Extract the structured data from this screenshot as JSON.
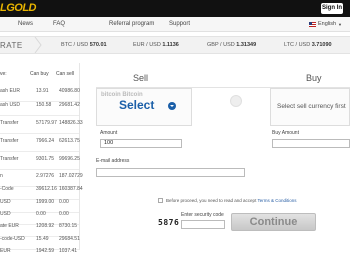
{
  "brand": {
    "logo": "LGOLD",
    "signin": "Sign In"
  },
  "nav": {
    "items": [
      "News",
      "FAQ",
      "Referral program",
      "Support"
    ],
    "language": "English"
  },
  "rates": {
    "label": "RATE",
    "items": [
      {
        "pair": "BTC / USD",
        "value": "570.01"
      },
      {
        "pair": "EUR / USD",
        "value": "1.1136"
      },
      {
        "pair": "GBP / USD",
        "value": "1.31349"
      },
      {
        "pair": "LTC / USD",
        "value": "3.71090"
      }
    ]
  },
  "left_table": {
    "head": "ve:",
    "col1": "Can buy",
    "col2": "Can sell",
    "rows": [
      {
        "name": "ash EUR",
        "v1": "13.91",
        "v2": "40986.80"
      },
      {
        "name": "ash USD",
        "v1": "150.58",
        "v2": "29681.42"
      },
      {
        "name": "Transfer",
        "v1": "57179.97",
        "v2": "148826.33"
      },
      {
        "name": "Transfer",
        "v1": "7966.24",
        "v2": "62613.75"
      },
      {
        "name": "Transfer",
        "v1": "9301.75",
        "v2": "99696.25"
      },
      {
        "name": "n",
        "v1": "2.97276",
        "v2": "187.02729"
      },
      {
        "name": "-Code",
        "v1": "39612.16",
        "v2": "160387.84"
      },
      {
        "name": "USD",
        "v1": "1999.00",
        "v2": "0.00"
      },
      {
        "name": "USD",
        "v1": "0.00",
        "v2": "0.00"
      },
      {
        "name": "ate EUR",
        "v1": "1208.92",
        "v2": "8730.15"
      },
      {
        "name": "-code-USD",
        "v1": "15.49",
        "v2": "29684.51"
      },
      {
        "name": "EUR",
        "v1": "1942.59",
        "v2": "1037.41"
      }
    ]
  },
  "sell": {
    "title": "Sell",
    "coins": "bitcoin   Bitcoin",
    "select": "Select",
    "amount_label": "Amount",
    "amount_value": "100"
  },
  "buy": {
    "title": "Buy",
    "placeholder": "Select sell currency first",
    "amount_label": "Buy Amount"
  },
  "form": {
    "email_label": "E-mail address",
    "agree_text": "Before proceed, you need to read and accept ",
    "agree_link": "Terms & Conditions",
    "security_label": "Enter security code",
    "captcha": "5876",
    "continue": "Continue"
  }
}
